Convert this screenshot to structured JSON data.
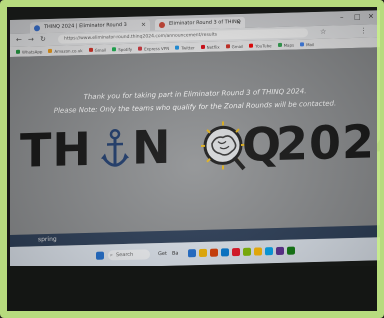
{
  "browser": {
    "tabs": [
      {
        "label": "THINQ 2024 | Eliminator Round 3",
        "active": true
      },
      {
        "label": "Eliminator Round 3 of THINQ",
        "active": false
      }
    ],
    "url": "https://www.eliminator-round.thinq2024.com/announcement/results",
    "bookmarks": [
      "WhatsApp",
      "Amazon.co.uk",
      "Gmail",
      "Spotify",
      "Express VPN",
      "Twitter",
      "Netflix",
      "Gmail",
      "YouTube",
      "Maps",
      "Mail"
    ],
    "bookmark_colors": [
      "#25a244",
      "#f7a21b",
      "#d93025",
      "#1db954",
      "#da3940",
      "#1d9bf0",
      "#e50914",
      "#d93025",
      "#ff0000",
      "#34a853",
      "#4285f4"
    ]
  },
  "page": {
    "message_1": "Thank you for taking part in Eliminator Round 3 of THINQ 2024.",
    "message_2": "Please Note: Only the teams who qualify for the Zonal Rounds will be contacted.",
    "logo": {
      "letters_1": "TH",
      "letters_2": "N",
      "letters_3": "Q",
      "year": "2024",
      "anchor_icon": "anchor-icon",
      "brain_icon": "brain-icon"
    }
  },
  "status": {
    "spring_label": "spring"
  },
  "taskbar": {
    "search_placeholder": "Search",
    "labels": [
      "Get",
      "Ba"
    ],
    "icon_colors": [
      "#1f6fd1",
      "#f3b400",
      "#d83b01",
      "#0078d4",
      "#e81123",
      "#7fba00",
      "#ffb900",
      "#00a4ef",
      "#5c2d91",
      "#107c10"
    ]
  }
}
